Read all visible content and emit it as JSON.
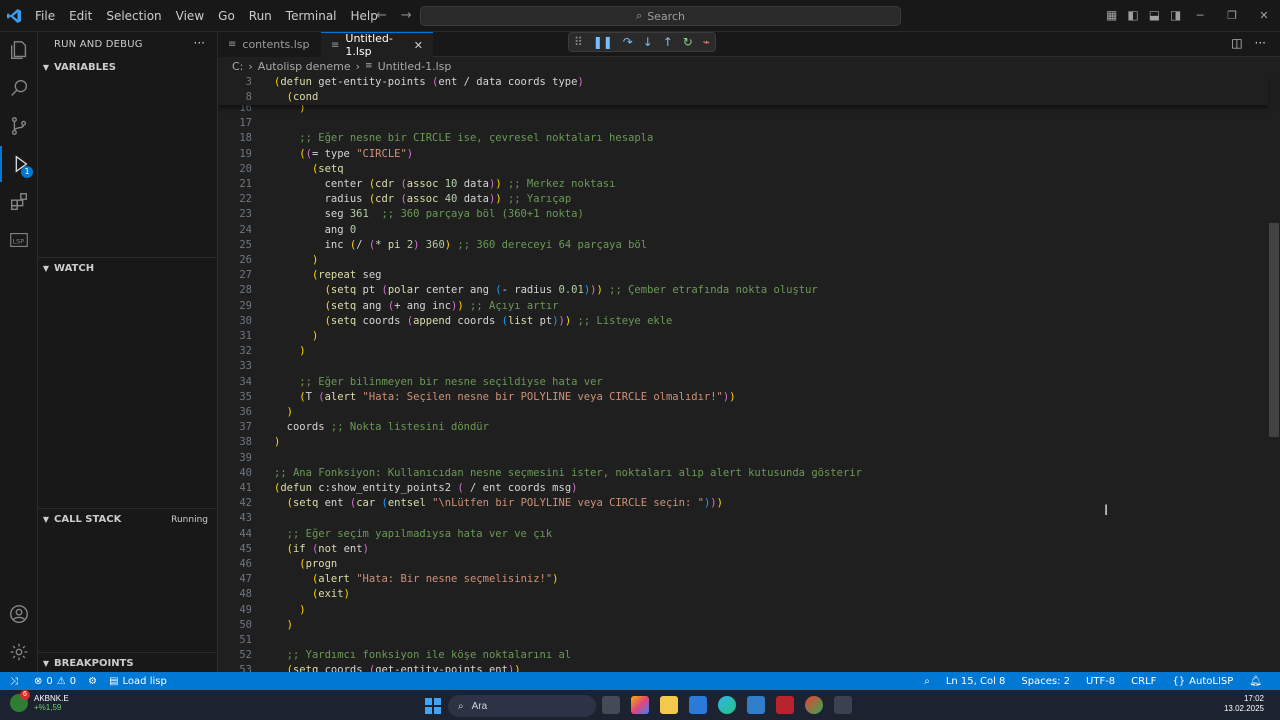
{
  "titlebar": {
    "menu": [
      "File",
      "Edit",
      "Selection",
      "View",
      "Go",
      "Run",
      "Terminal",
      "Help"
    ],
    "search_placeholder": "Search"
  },
  "sidebar": {
    "title": "RUN AND DEBUG",
    "more": "···",
    "sections": {
      "variables": "VARIABLES",
      "watch": "WATCH",
      "call_stack": "CALL STACK",
      "call_stack_status": "Running",
      "breakpoints": "BREAKPOINTS"
    },
    "debug_badge": "1"
  },
  "tabs": [
    {
      "label": "contents.lsp",
      "icon": "lsp-file-icon"
    },
    {
      "label": "Untitled-1.lsp",
      "icon": "lsp-file-icon",
      "active": true
    }
  ],
  "breadcrumb": {
    "root": "C:",
    "folder": "Autolisp deneme",
    "file": "Untitled-1.lsp"
  },
  "editor": {
    "sticky_lines": [
      {
        "no": "3",
        "code": "(defun get-entity-points (ent / data coords type)"
      },
      {
        "no": "8",
        "code": "  (cond"
      }
    ],
    "lines": [
      {
        "no": "16",
        "code": "    )"
      },
      {
        "no": "17",
        "code": ""
      },
      {
        "no": "18",
        "code": "    ;; Eğer nesne bir CIRCLE ise, çevresel noktaları hesapla"
      },
      {
        "no": "19",
        "code": "    ((= type \"CIRCLE\")"
      },
      {
        "no": "20",
        "code": "      (setq"
      },
      {
        "no": "21",
        "code": "        center (cdr (assoc 10 data)) ;; Merkez noktası"
      },
      {
        "no": "22",
        "code": "        radius (cdr (assoc 40 data)) ;; Yarıçap"
      },
      {
        "no": "23",
        "code": "        seg 361  ;; 360 parçaya böl (360+1 nokta)"
      },
      {
        "no": "24",
        "code": "        ang 0"
      },
      {
        "no": "25",
        "code": "        inc (/ (* pi 2) 360) ;; 360 dereceyi 64 parçaya böl"
      },
      {
        "no": "26",
        "code": "      )"
      },
      {
        "no": "27",
        "code": "      (repeat seg"
      },
      {
        "no": "28",
        "code": "        (setq pt (polar center ang (- radius 0.01))) ;; Çember etrafında nokta oluştur"
      },
      {
        "no": "29",
        "code": "        (setq ang (+ ang inc)) ;; Açıyı artır"
      },
      {
        "no": "30",
        "code": "        (setq coords (append coords (list pt))) ;; Listeye ekle"
      },
      {
        "no": "31",
        "code": "      )"
      },
      {
        "no": "32",
        "code": "    )"
      },
      {
        "no": "33",
        "code": ""
      },
      {
        "no": "34",
        "code": "    ;; Eğer bilinmeyen bir nesne seçildiyse hata ver"
      },
      {
        "no": "35",
        "code": "    (T (alert \"Hata: Seçilen nesne bir POLYLINE veya CIRCLE olmalıdır!\"))"
      },
      {
        "no": "36",
        "code": "  )"
      },
      {
        "no": "37",
        "code": "  coords ;; Nokta listesini döndür"
      },
      {
        "no": "38",
        "code": ")"
      },
      {
        "no": "39",
        "code": ""
      },
      {
        "no": "40",
        "code": ";; Ana Fonksiyon: Kullanıcıdan nesne seçmesini ister, noktaları alıp alert kutusunda gösterir"
      },
      {
        "no": "41",
        "code": "(defun c:show_entity_points2 ( / ent coords msg)"
      },
      {
        "no": "42",
        "code": "  (setq ent (car (entsel \"\\nLütfen bir POLYLINE veya CIRCLE seçin: \")))"
      },
      {
        "no": "43",
        "code": ""
      },
      {
        "no": "44",
        "code": "  ;; Eğer seçim yapılmadıysa hata ver ve çık"
      },
      {
        "no": "45",
        "code": "  (if (not ent)"
      },
      {
        "no": "46",
        "code": "    (progn"
      },
      {
        "no": "47",
        "code": "      (alert \"Hata: Bir nesne seçmelisiniz!\")"
      },
      {
        "no": "48",
        "code": "      (exit)"
      },
      {
        "no": "49",
        "code": "    )"
      },
      {
        "no": "50",
        "code": "  )"
      },
      {
        "no": "51",
        "code": ""
      },
      {
        "no": "52",
        "code": "  ;; Yardımcı fonksiyon ile köşe noktalarını al"
      },
      {
        "no": "53",
        "code": "  (setq coords (get-entity-points ent))"
      }
    ]
  },
  "statusbar": {
    "errors": "0",
    "warnings": "0",
    "task": "Load lisp",
    "position": "Ln 15, Col 8",
    "spaces": "Spaces: 2",
    "encoding": "UTF-8",
    "eol": "CRLF",
    "language": "AutoLISP",
    "color": "#0078d4"
  },
  "taskbar": {
    "stock_badge": "6",
    "stock_name": "AKBNK.E",
    "stock_change": "+%1,59",
    "search_text": "Ara",
    "time": "17:02",
    "date": "13.02.2025"
  }
}
